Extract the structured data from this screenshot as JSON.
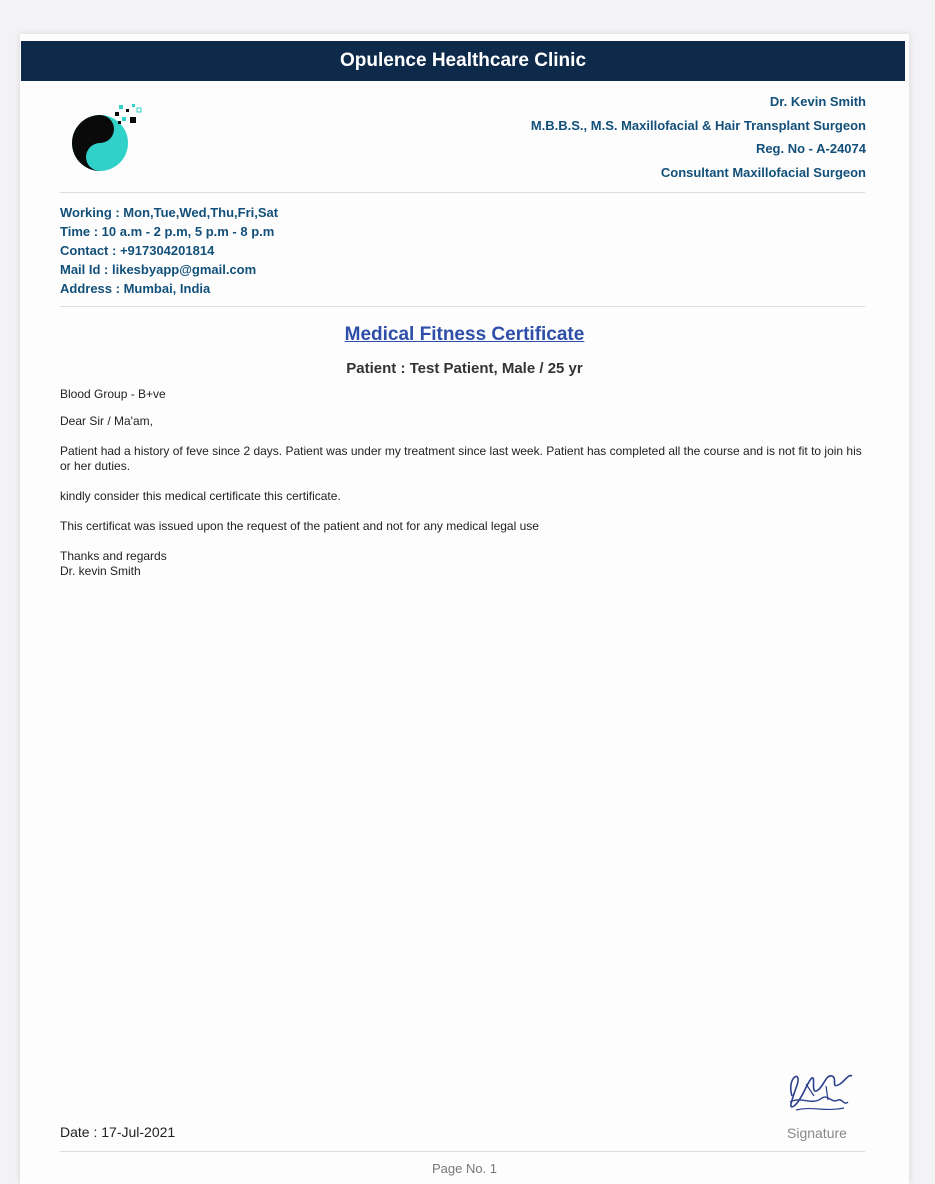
{
  "clinic": {
    "name": "Opulence Healthcare Clinic"
  },
  "doctor": {
    "name": "Dr. Kevin Smith",
    "qualification": "M.B.B.S., M.S. Maxillofacial & Hair Transplant Surgeon",
    "reg_no": "Reg. No - A-24074",
    "role": "Consultant Maxillofacial Surgeon"
  },
  "info": {
    "working": "Working : Mon,Tue,Wed,Thu,Fri,Sat",
    "time": "Time : 10 a.m - 2 p.m, 5 p.m - 8 p.m",
    "contact": "Contact : +917304201814",
    "mail": "Mail Id : likesbyapp@gmail.com",
    "address": "Address : Mumbai, India"
  },
  "certificate": {
    "title": "Medical Fitness Certificate",
    "patient": "Patient : Test Patient, Male / 25 yr",
    "blood_group": "Blood Group - B+ve",
    "salutation": "Dear Sir / Ma'am,",
    "paragraph1": "Patient had a history of feve since 2 days. Patient was under my treatment since last week. Patient has completed all the course and  is not fit to join his or her duties.",
    "paragraph2": "kindly consider this medical certificate this certificate.",
    "paragraph3": "This certificat was issued upon the request of the patient and not for any medical legal use",
    "closing": "Thanks and regards",
    "closing_name": "Dr. kevin Smith"
  },
  "footer": {
    "date": "Date : 17-Jul-2021",
    "signature_label": "Signature",
    "page_no": "Page No. 1"
  },
  "colors": {
    "header_bar": "#0e2a4a",
    "accent_text": "#12507a",
    "title_link": "#2d4fa8",
    "logo_teal": "#2fd1c8"
  }
}
